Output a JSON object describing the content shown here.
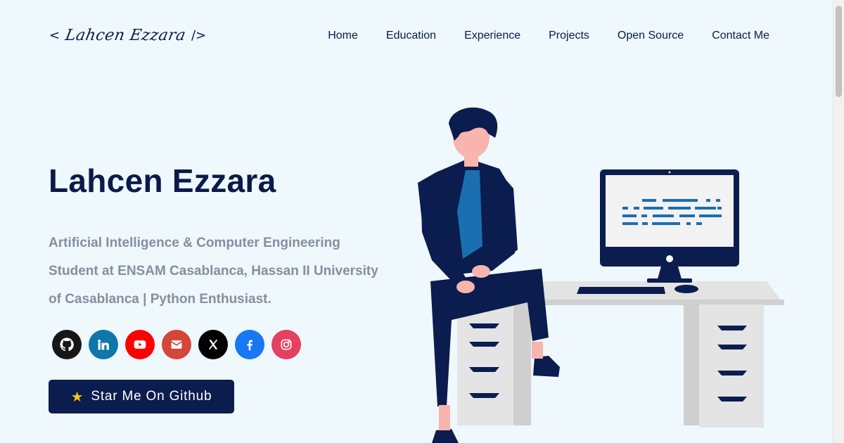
{
  "header": {
    "logo_open": "<",
    "logo_name": "Lahcen Ezzara",
    "logo_close": "/>",
    "nav": [
      "Home",
      "Education",
      "Experience",
      "Projects",
      "Open Source",
      "Contact Me"
    ]
  },
  "hero": {
    "title": "Lahcen Ezzara",
    "subtitle": "Artificial Intelligence & Computer Engineering Student at ENSAM Casablanca, Hassan II University of Casablanca | Python Enthusiast.",
    "star_button_icon": "★",
    "star_button_label": "Star Me On Github"
  },
  "socials": [
    {
      "icon": "github-icon",
      "color": "#181717"
    },
    {
      "icon": "linkedin-icon",
      "color": "#0e76a8"
    },
    {
      "icon": "youtube-icon",
      "color": "#ff0000"
    },
    {
      "icon": "email-icon",
      "color": "#d44638"
    },
    {
      "icon": "x-icon",
      "color": "#000000"
    },
    {
      "icon": "facebook-icon",
      "color": "#1877f2"
    },
    {
      "icon": "instagram-icon",
      "color": "#e4405f"
    }
  ],
  "colors": {
    "background": "#eef8fd",
    "primary": "#0b1c4e",
    "muted_text": "#868e9f",
    "accent_blue": "#1a6fb0"
  }
}
